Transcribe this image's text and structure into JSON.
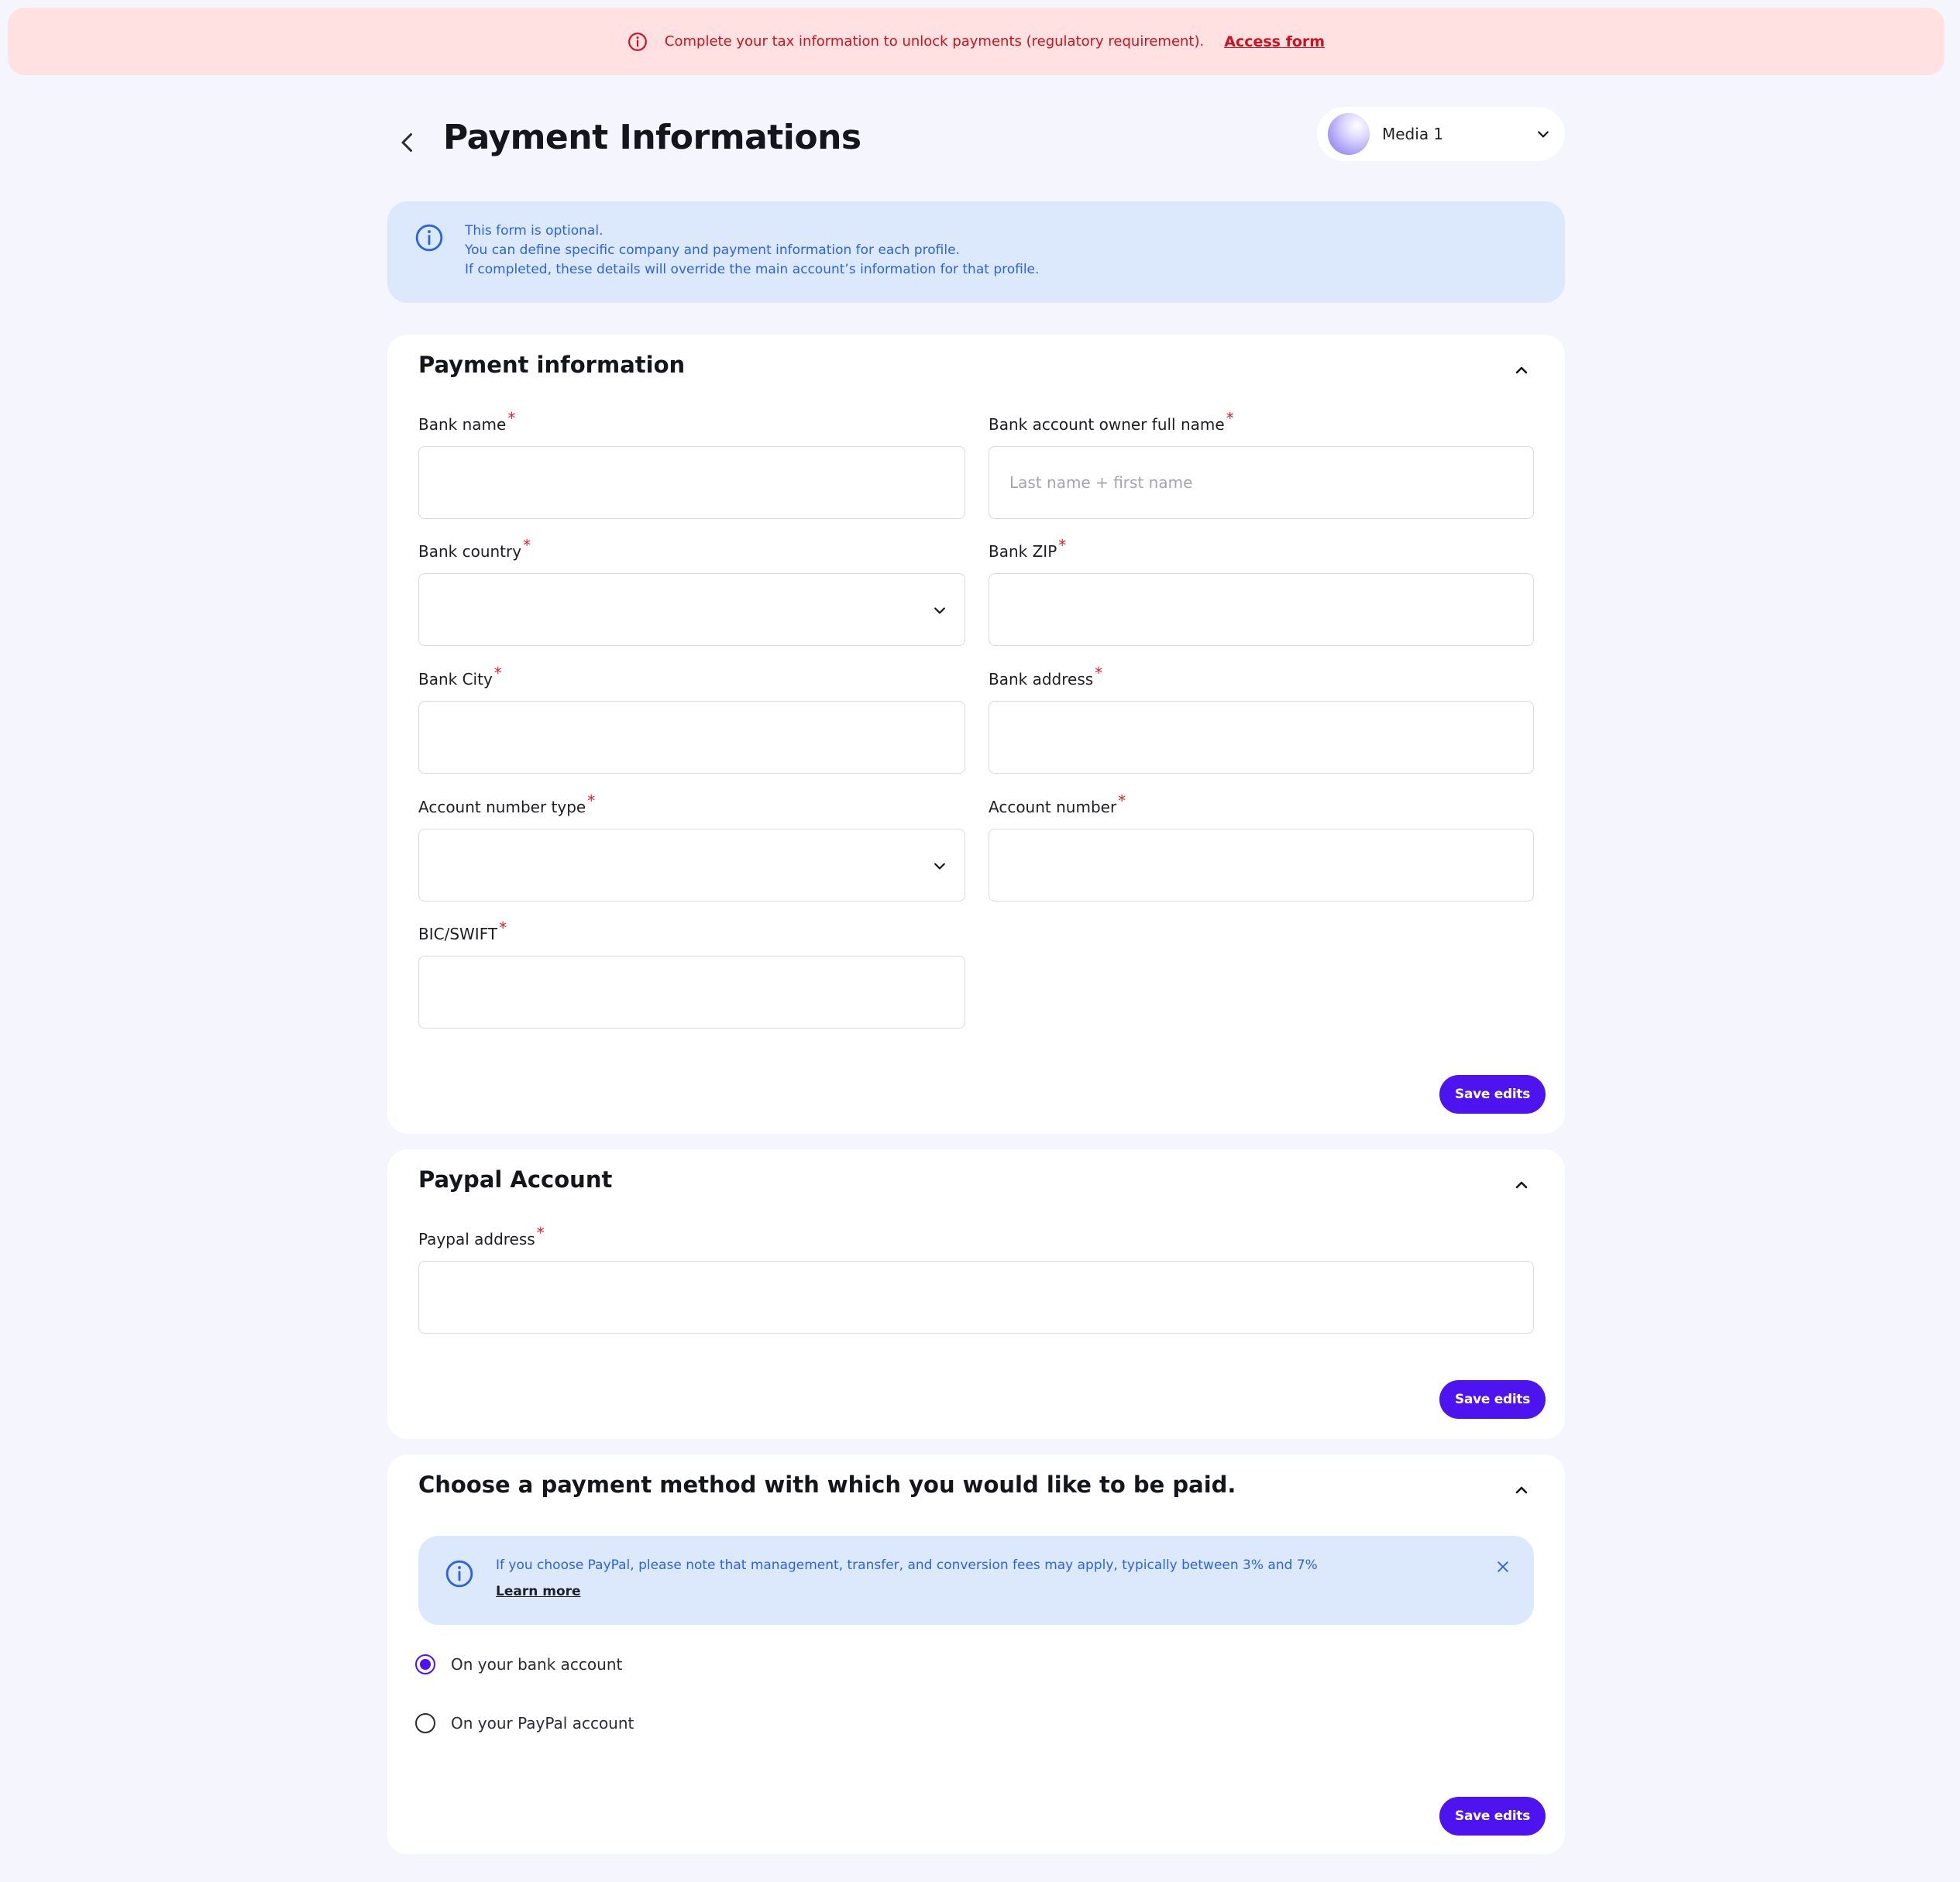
{
  "alert": {
    "message": "Complete your tax information to unlock payments (regulatory requirement).",
    "link": "Access form"
  },
  "header": {
    "title": "Payment Informations",
    "profile": "Media 1"
  },
  "info": {
    "line1": "This form is optional.",
    "line2": "You can define specific company and payment information for each profile.",
    "line3": "If completed, these details will override the main account’s information for that profile."
  },
  "payment": {
    "title": "Payment information",
    "fields": {
      "bank_name": {
        "label": "Bank name",
        "value": ""
      },
      "owner": {
        "label": "Bank account owner full name",
        "placeholder": "Last name + first name",
        "value": ""
      },
      "country": {
        "label": "Bank country",
        "value": ""
      },
      "zip": {
        "label": "Bank ZIP",
        "value": ""
      },
      "city": {
        "label": "Bank City",
        "value": ""
      },
      "address": {
        "label": "Bank address",
        "value": ""
      },
      "acct_type": {
        "label": "Account number type",
        "value": ""
      },
      "acct_num": {
        "label": "Account number",
        "value": ""
      },
      "bic": {
        "label": "BIC/SWIFT",
        "value": ""
      }
    },
    "required_mark": "*",
    "save": "Save edits"
  },
  "paypal": {
    "title": "Paypal Account",
    "address_label": "Paypal address",
    "address_value": "",
    "save": "Save edits"
  },
  "method": {
    "title": "Choose a payment method with which you would like to be paid.",
    "note": "If you choose PayPal, please note that management, transfer, and conversion fees may apply, typically between 3% and 7%",
    "learn_more": "Learn more",
    "options": [
      {
        "label": "On your bank account",
        "checked": true
      },
      {
        "label": "On your PayPal account",
        "checked": false
      }
    ],
    "save": "Save edits"
  },
  "colors": {
    "accent": "#4d14ef",
    "alert_bg": "#fee1e0",
    "alert_text": "#d0101f",
    "info_bg": "#dce9fd",
    "info_text": "#2c63e0",
    "page_bg": "#f4f5fd"
  },
  "icons": [
    "alert-circle-icon",
    "back-arrow-icon",
    "chevron-down-icon",
    "info-icon",
    "chevron-up-icon",
    "close-icon"
  ]
}
